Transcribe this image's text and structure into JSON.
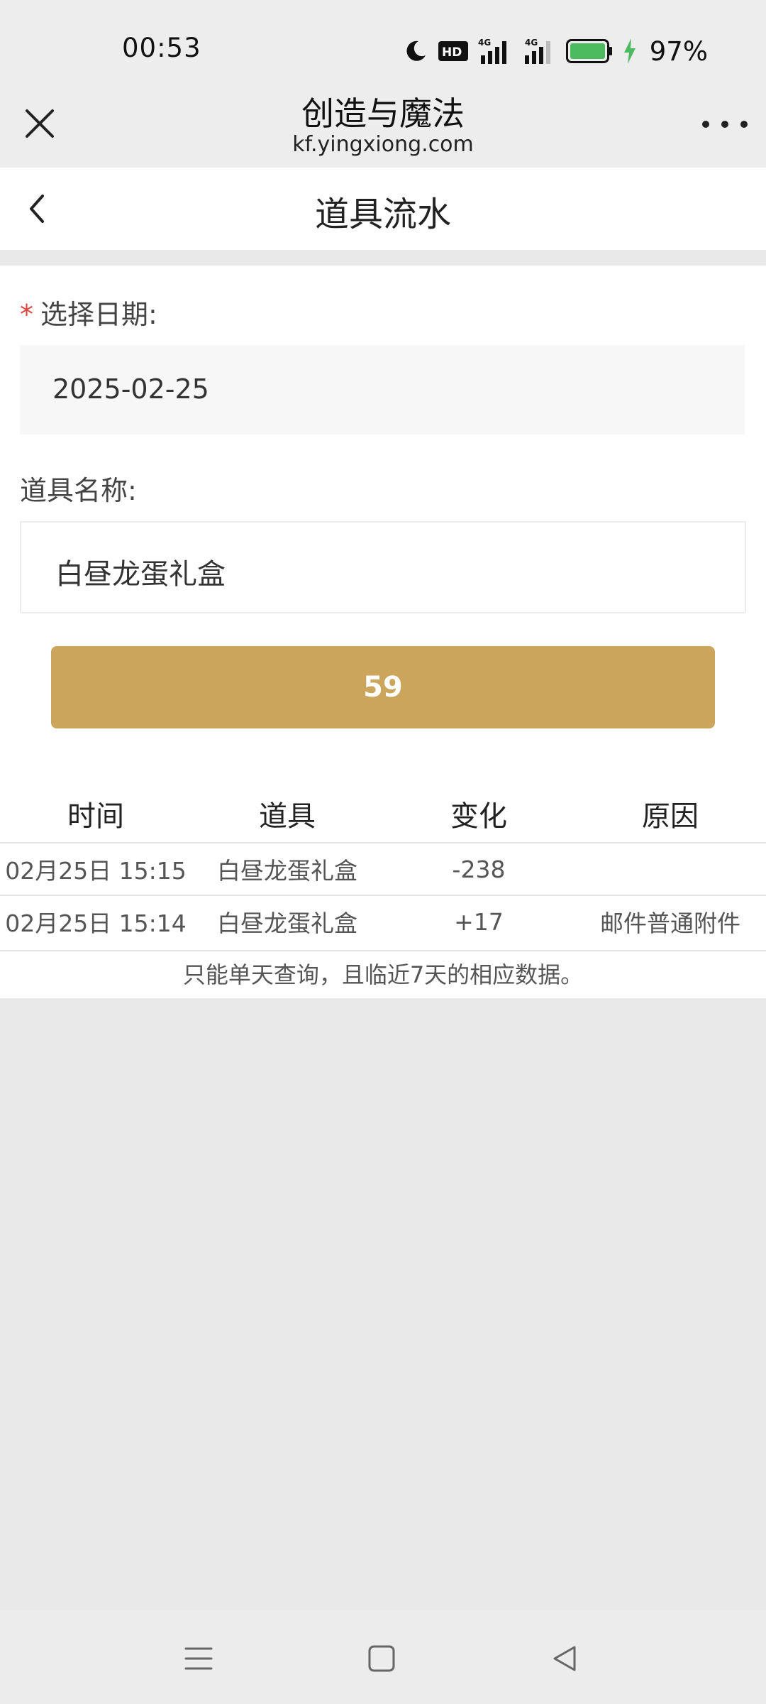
{
  "status_bar": {
    "time": "00:53",
    "battery_pct": "97%",
    "icons": [
      "moon-icon",
      "hd-icon",
      "signal-4g-icon",
      "signal-4g-icon",
      "battery-icon",
      "charging-icon"
    ]
  },
  "web_bar": {
    "title": "创造与魔法",
    "url": "kf.yingxiong.com"
  },
  "page": {
    "title": "道具流水"
  },
  "form": {
    "required_mark": "*",
    "date_label": "选择日期:",
    "date_value": "2025-02-25",
    "item_label": "道具名称:",
    "item_value": "白昼龙蛋礼盒",
    "submit_label": "59"
  },
  "table": {
    "headers": [
      "时间",
      "道具",
      "变化",
      "原因"
    ],
    "rows": [
      {
        "time": "02月25日 15:15",
        "item": "白昼龙蛋礼盒",
        "change": "-238",
        "reason": ""
      },
      {
        "time": "02月25日 15:14",
        "item": "白昼龙蛋礼盒",
        "change": "+17",
        "reason": "邮件普通附件"
      }
    ]
  },
  "note": "只能单天查询，且临近7天的相应数据。",
  "colors": {
    "accent": "#caa55b",
    "required": "#e0443e",
    "battery": "#4cba5f"
  }
}
